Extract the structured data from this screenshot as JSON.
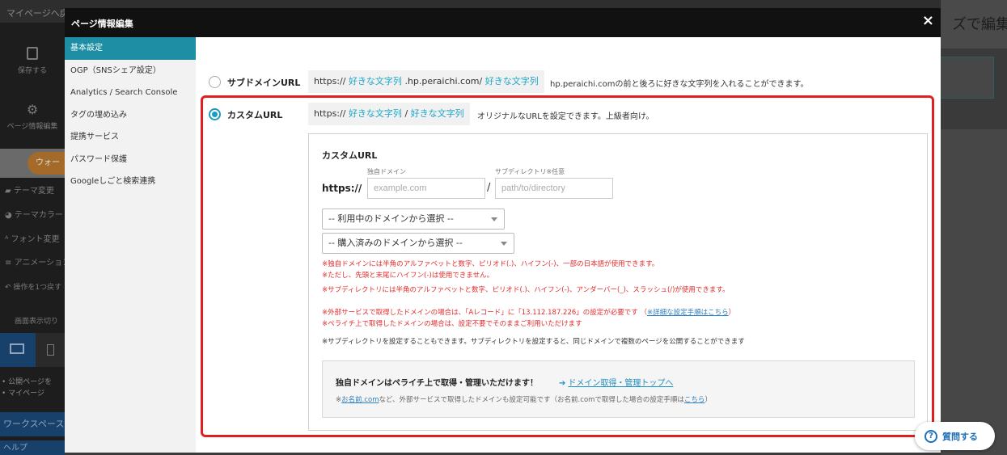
{
  "background": {
    "topbar_back": "マイページへ戻る",
    "topbar_crumb": "",
    "sidebar_items": [
      {
        "label": "保存する",
        "icon": "save-icon"
      },
      {
        "label": "ページ情報編集",
        "icon": "gear-icon"
      }
    ],
    "sidebar_orange": "ウォー",
    "sidebar_rows": [
      {
        "label": "テーマ変更",
        "icon": "brush-icon"
      },
      {
        "label": "テーマカラー",
        "icon": "palette-icon"
      },
      {
        "label": "フォント変更",
        "icon": "font-icon"
      },
      {
        "label": "アニメーション",
        "icon": "animation-icon"
      },
      {
        "label": "操作を1つ戻す",
        "icon": "undo-icon"
      },
      {
        "label": "画面表示切り",
        "icon": ""
      }
    ],
    "sidebar_links": [
      "公開ページを",
      "マイページ"
    ],
    "workspace_label": "ワークスペース",
    "bottom_label": "ヘルプ",
    "main_title_fragment": "ズで編集中"
  },
  "modal": {
    "title": "ページ情報編集",
    "close": "×",
    "nav": [
      {
        "label": "基本設定",
        "active": true
      },
      {
        "label": "OGP（SNSシェア設定）",
        "active": false
      },
      {
        "label": "Analytics / Search Console",
        "active": false
      },
      {
        "label": "タグの埋め込み",
        "active": false
      },
      {
        "label": "提携サービス",
        "active": false
      },
      {
        "label": "パスワード保護",
        "active": false
      },
      {
        "label": "Googleしごと検索連携",
        "active": false
      }
    ],
    "subdomain": {
      "label": "サブドメインURL",
      "prefix": "https://",
      "part1": "好きな文字列",
      "middle": ".hp.peraichi.com/",
      "part2": "好きな文字列",
      "desc": "hp.peraichi.comの前と後ろに好きな文字列を入れることができます。"
    },
    "custom": {
      "label": "カスタムURL",
      "prefix": "https://",
      "part1": "好きな文字列",
      "sep": "/",
      "part2": "好きな文字列",
      "desc": "オリジナルなURLを設定できます。上級者向け。",
      "box_title": "カスタムURL",
      "domain_caption": "独自ドメイン",
      "subdir_caption": "サブディレクトリ※任意",
      "https_label": "https://",
      "domain_placeholder": "example.com",
      "subdir_placeholder": "path/to/directory",
      "slash": "/",
      "select_in_use": "-- 利用中のドメインから選択 --",
      "select_purchased": "-- 購入済みのドメインから選択 --",
      "notes": [
        "※独自ドメインには半角のアルファベットと数字、ピリオド(.)、ハイフン(-)、一部の日本語が使用できます。",
        "※ただし、先頭と末尾にハイフン(-)は使用できません。",
        "※サブディレクトリには半角のアルファベットと数字、ピリオド(.)、ハイフン(-)、アンダーバー(_)、スラッシュ(/)が使用できます。"
      ],
      "note_external": "※外部サービスで取得したドメインの場合は、「Aレコード」に「13.112.187.226」の設定が必要です （",
      "note_external_link": "※詳細な設定手順はこちら",
      "note_external_close": "）",
      "note_peraichi": "※ペライチ上で取得したドメインの場合は、設定不要でそのままご利用いただけます",
      "note_subdir": "※サブディレクトリを設定することもできます。サブディレクトリを設定すると、同じドメインで複数のページを公開することができます",
      "promo_head": "独自ドメインはペライチ上で取得・管理いただけます！",
      "promo_link": "ドメイン取得・管理トップへ",
      "promo_sub_prefix": "※",
      "promo_sub_link1": "お名前.com",
      "promo_sub_mid": "など、外部サービスで取得したドメインも設定可能です（お名前.comで取得した場合の設定手順は",
      "promo_sub_link2": "こちら",
      "promo_sub_close": "）"
    }
  },
  "help": {
    "label": "質問する",
    "icon_glyph": "?"
  },
  "colors": {
    "accent": "#1d8ea3",
    "link": "#1aa7c8",
    "warning": "#e52b2b",
    "highlight": "#e02020"
  }
}
